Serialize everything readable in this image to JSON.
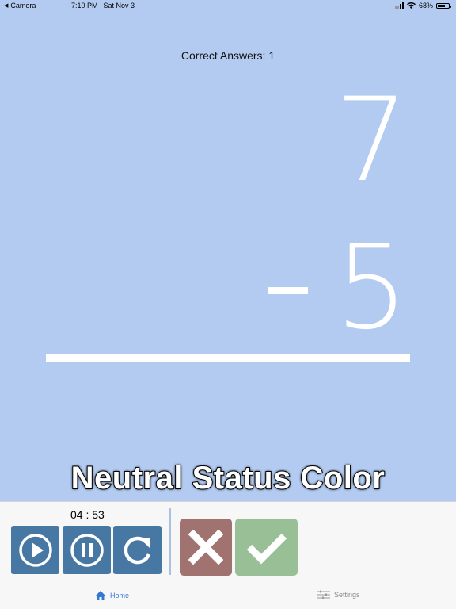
{
  "status_bar": {
    "back_app": "Camera",
    "time": "7:10 PM",
    "date": "Sat Nov 3",
    "battery": "68%",
    "battery_level": 0.68
  },
  "problem": {
    "correct_label": "Correct Answers: 1",
    "top_number": "7",
    "bottom_number": "5",
    "operator": "minus"
  },
  "caption": "Neutral Status Color",
  "controls": {
    "timer": "04 : 53",
    "play_icon": "play-icon",
    "pause_icon": "pause-icon",
    "reset_icon": "reset-icon",
    "wrong_icon": "x-icon",
    "right_icon": "check-icon"
  },
  "colors": {
    "background": "#b3cbf1",
    "control_blue": "#4777a3",
    "wrong_red": "#a07370",
    "right_green": "#98bf96",
    "tab_active": "#3478d4"
  },
  "tabs": [
    {
      "label": "Home",
      "icon": "home-icon",
      "active": true
    },
    {
      "label": "Settings",
      "icon": "settings-icon",
      "active": false
    }
  ]
}
